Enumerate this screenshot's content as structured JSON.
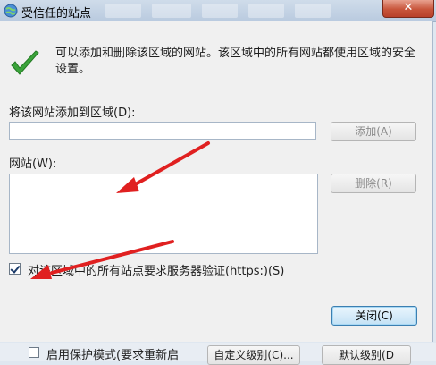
{
  "window": {
    "title": "受信任的站点",
    "close_label": "✕"
  },
  "info_text": "可以添加和删除该区域的网站。该区域中的所有网站都使用区域的安全设置。",
  "add_site": {
    "label": "将该网站添加到区域(D):",
    "value": "",
    "add_button": "添加(A)"
  },
  "websites": {
    "label": "网站(W):",
    "items": [],
    "remove_button": "删除(R)"
  },
  "https_checkbox": {
    "label": "对该区域中的所有站点要求服务器验证(https:)(S)",
    "checked": true
  },
  "close_button": "关闭(C)",
  "background_window": {
    "protected_mode_label": "启用保护模式(要求重新启",
    "custom_level_button": "自定义级别(C)...",
    "default_level_button": "默认级别(D"
  },
  "colors": {
    "arrow": "#e02020",
    "check": "#3aa33a",
    "close_button": "#c8553b"
  }
}
